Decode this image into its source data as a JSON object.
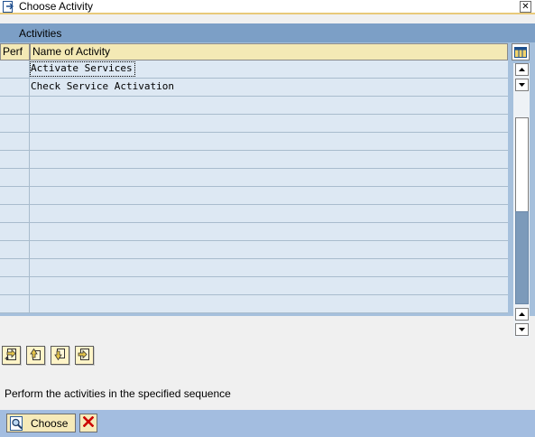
{
  "window": {
    "title": "Choose Activity",
    "close_glyph": "✕"
  },
  "table": {
    "title": "Activities",
    "columns": [
      "Perf",
      "Name of Activity"
    ],
    "rows": [
      {
        "perf": "",
        "name": "Activate Services",
        "focused": true
      },
      {
        "perf": "",
        "name": "Check Service Activation",
        "focused": false
      },
      {
        "perf": "",
        "name": ""
      },
      {
        "perf": "",
        "name": ""
      },
      {
        "perf": "",
        "name": ""
      },
      {
        "perf": "",
        "name": ""
      },
      {
        "perf": "",
        "name": ""
      },
      {
        "perf": "",
        "name": ""
      },
      {
        "perf": "",
        "name": ""
      },
      {
        "perf": "",
        "name": ""
      },
      {
        "perf": "",
        "name": ""
      },
      {
        "perf": "",
        "name": ""
      },
      {
        "perf": "",
        "name": ""
      },
      {
        "perf": "",
        "name": ""
      }
    ]
  },
  "toolbar": {
    "buttons": [
      "insert-row-icon",
      "move-up-icon",
      "move-down-icon",
      "details-icon"
    ]
  },
  "hint": "Perform the activities in the specified sequence",
  "footer": {
    "choose_label": "Choose"
  },
  "colors": {
    "table_bg": "#a6c0dc",
    "title_band": "#7c9fc6",
    "header_bg": "#f4e9b5",
    "row_bg": "#dde8f3",
    "footer_bg": "#a3bde0",
    "button_bg": "#f6eab9",
    "cancel_red": "#cc0000"
  }
}
